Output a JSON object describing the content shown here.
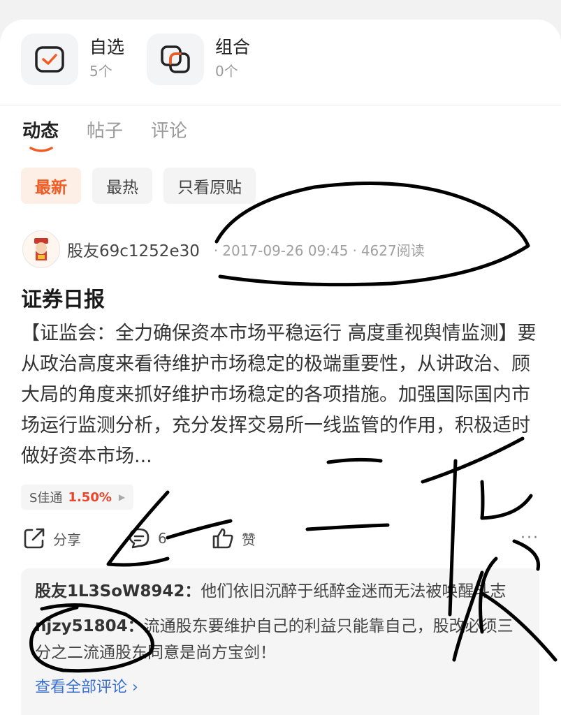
{
  "entries": [
    {
      "title": "自选",
      "count": "5个",
      "icon": "checkbox-icon"
    },
    {
      "title": "组合",
      "count": "0个",
      "icon": "portfolio-icon"
    }
  ],
  "tabs": [
    "动态",
    "帖子",
    "评论"
  ],
  "filters": [
    "最新",
    "最热",
    "只看原贴"
  ],
  "post": {
    "author": "股友69c1252e30",
    "datetime": "2017-09-26 09:45",
    "reads": "4627阅读",
    "title": "证券日报",
    "body": "【证监会：全力确保资本市场平稳运行 高度重视舆情监测】要从政治高度来看待维护市场稳定的极端重要性，从讲政治、顾大局的角度来抓好维护市场稳定的各项措施。加强国际国内市场运行监测分析，充分发挥交易所一线监管的作用，积极适时做好资本市场...",
    "stock": {
      "name": "S佳通",
      "change": "1.50%",
      "color": "#e8452b"
    },
    "actions": {
      "share": "分享",
      "comments": "6",
      "like": "赞"
    }
  },
  "comments": [
    {
      "user": "股友1L3SoW8942：",
      "text": "他们依旧沉醉于纸醉金迷而无法被唤醒斗志"
    },
    {
      "user": "njzy51804：",
      "text": "流通股东要维护自己的利益只能靠自己，股改必须三分之二流通股东同意是尚方宝剑！"
    }
  ],
  "view_all": "查看全部评论 ›",
  "accent": "#f15b24"
}
